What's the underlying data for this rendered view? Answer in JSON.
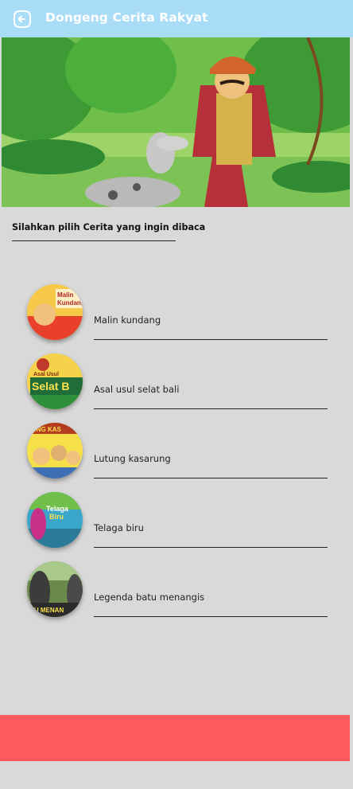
{
  "app_bar": {
    "title": "Dongeng Cerita Rakyat",
    "back_icon": "back-arrow-icon",
    "background": "#a9dcf7"
  },
  "prompt": {
    "text": "Silahkan pilih Cerita yang ingin dibaca"
  },
  "stories": [
    {
      "label": "Malin kundang",
      "thumb_text": "Malin Kundang",
      "thumb_colors": [
        "#f7c948",
        "#e8402a"
      ]
    },
    {
      "label": "Asal usul selat bali",
      "thumb_text": "Asal Usul Selat Bali",
      "thumb_colors": [
        "#f6d24b",
        "#2f8f3a"
      ]
    },
    {
      "label": "Lutung kasarung",
      "thumb_text": "Lutung Kasarung",
      "thumb_colors": [
        "#f5e04a",
        "#b33b1e"
      ]
    },
    {
      "label": "Telaga biru",
      "thumb_text": "Telaga Biru",
      "thumb_colors": [
        "#3aa6c9",
        "#c9308a"
      ]
    },
    {
      "label": "Legenda batu menangis",
      "thumb_text": "Batu Menangis",
      "thumb_colors": [
        "#6b8a4a",
        "#3c3c3c"
      ]
    }
  ],
  "footer": {
    "background": "#ff5a5f"
  }
}
